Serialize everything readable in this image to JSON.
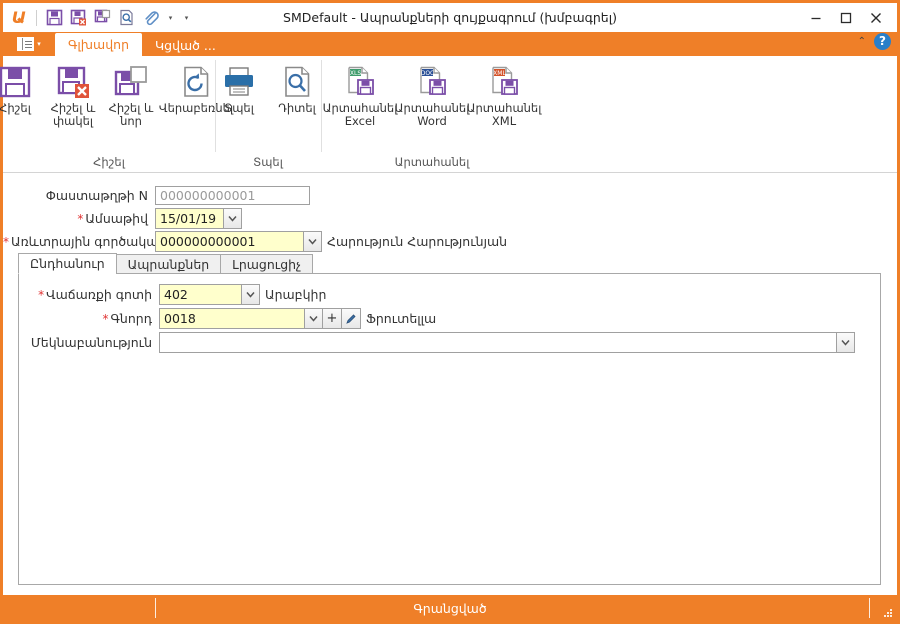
{
  "window": {
    "title": "SMDefault - Ապրանքների զույքագրում (խմբագրել)",
    "minimize_label": "—",
    "maximize_label": "□",
    "close_label": "✕"
  },
  "quick_access": {
    "logo_glyph": "Ա",
    "buttons": [
      {
        "name": "save-icon",
        "tooltip": "Հիշել"
      },
      {
        "name": "save-and-close-icon",
        "tooltip": "Հիշել և փակել"
      },
      {
        "name": "save-and-new-icon",
        "tooltip": "Հիշել և նոր"
      },
      {
        "name": "preview-icon",
        "tooltip": "Դիտել"
      },
      {
        "name": "attachment-icon",
        "tooltip": "Կցված"
      }
    ],
    "dropdown_caret": "▾",
    "customize_caret": "▾"
  },
  "ribbon": {
    "file_menu_caret": "▾",
    "tabs": [
      {
        "label": "Գլխավոր",
        "active": true
      },
      {
        "label": "Կցված ...",
        "active": false
      }
    ],
    "collapse_caret": "⌃",
    "help_label": "?",
    "groups": [
      {
        "label": "Հիշել",
        "buttons": [
          {
            "label": "Հիշել",
            "icon": "save-icon"
          },
          {
            "label": "Հիշել և փակել",
            "icon": "save-close-icon"
          },
          {
            "label": "Հիշել և նոր",
            "icon": "save-new-icon"
          },
          {
            "label": "Վերաբեռնել",
            "icon": "refresh-icon"
          }
        ]
      },
      {
        "label": "Տպել",
        "buttons": [
          {
            "label": "Տպել",
            "icon": "printer-icon"
          },
          {
            "label": "Դիտել",
            "icon": "preview-icon"
          }
        ]
      },
      {
        "label": "Արտահանել",
        "buttons": [
          {
            "label": "Արտահանել Excel",
            "icon": "export-excel-icon",
            "badge": "XLS"
          },
          {
            "label": "Արտահանել Word",
            "icon": "export-word-icon",
            "badge": "DOC"
          },
          {
            "label": "Արտահանել XML",
            "icon": "export-xml-icon",
            "badge": "XML"
          }
        ]
      }
    ]
  },
  "form": {
    "doc_number": {
      "label": "Փաստաթղթի N",
      "value": "000000000001",
      "readonly": true
    },
    "date": {
      "label": "Ամսաթիվ",
      "value": "15/01/19",
      "required": true
    },
    "agent": {
      "label": "Առևտրային գործակալ",
      "value": "000000000001",
      "display": "Հարություն Հարությունյան",
      "required": true
    },
    "required_mark": "*",
    "dropdown_caret": "⌄"
  },
  "tab_control": {
    "tabs": [
      {
        "label": "Ընդհանուր",
        "active": true
      },
      {
        "label": "Ապրանքներ",
        "active": false
      },
      {
        "label": "Լրացուցիչ",
        "active": false
      }
    ],
    "fields": {
      "zone": {
        "label": "Վաճառքի գոտի",
        "value": "402",
        "display": "Արաբկիր",
        "required": true
      },
      "customer": {
        "label": "Գնորդ",
        "value": "0018",
        "display": "Ֆրուտելլա",
        "required": true,
        "add_label": "+",
        "edit_label": "✎"
      },
      "comment": {
        "label": "Մեկնաբանություն",
        "value": "",
        "required": false
      }
    }
  },
  "statusbar": {
    "status_text": "Գրանցված",
    "left_text": ""
  },
  "colors": {
    "accent": "#ef7f28",
    "field_highlight": "#ffffcc",
    "required_mark": "#e03131",
    "help_blue": "#2a7fc9"
  }
}
